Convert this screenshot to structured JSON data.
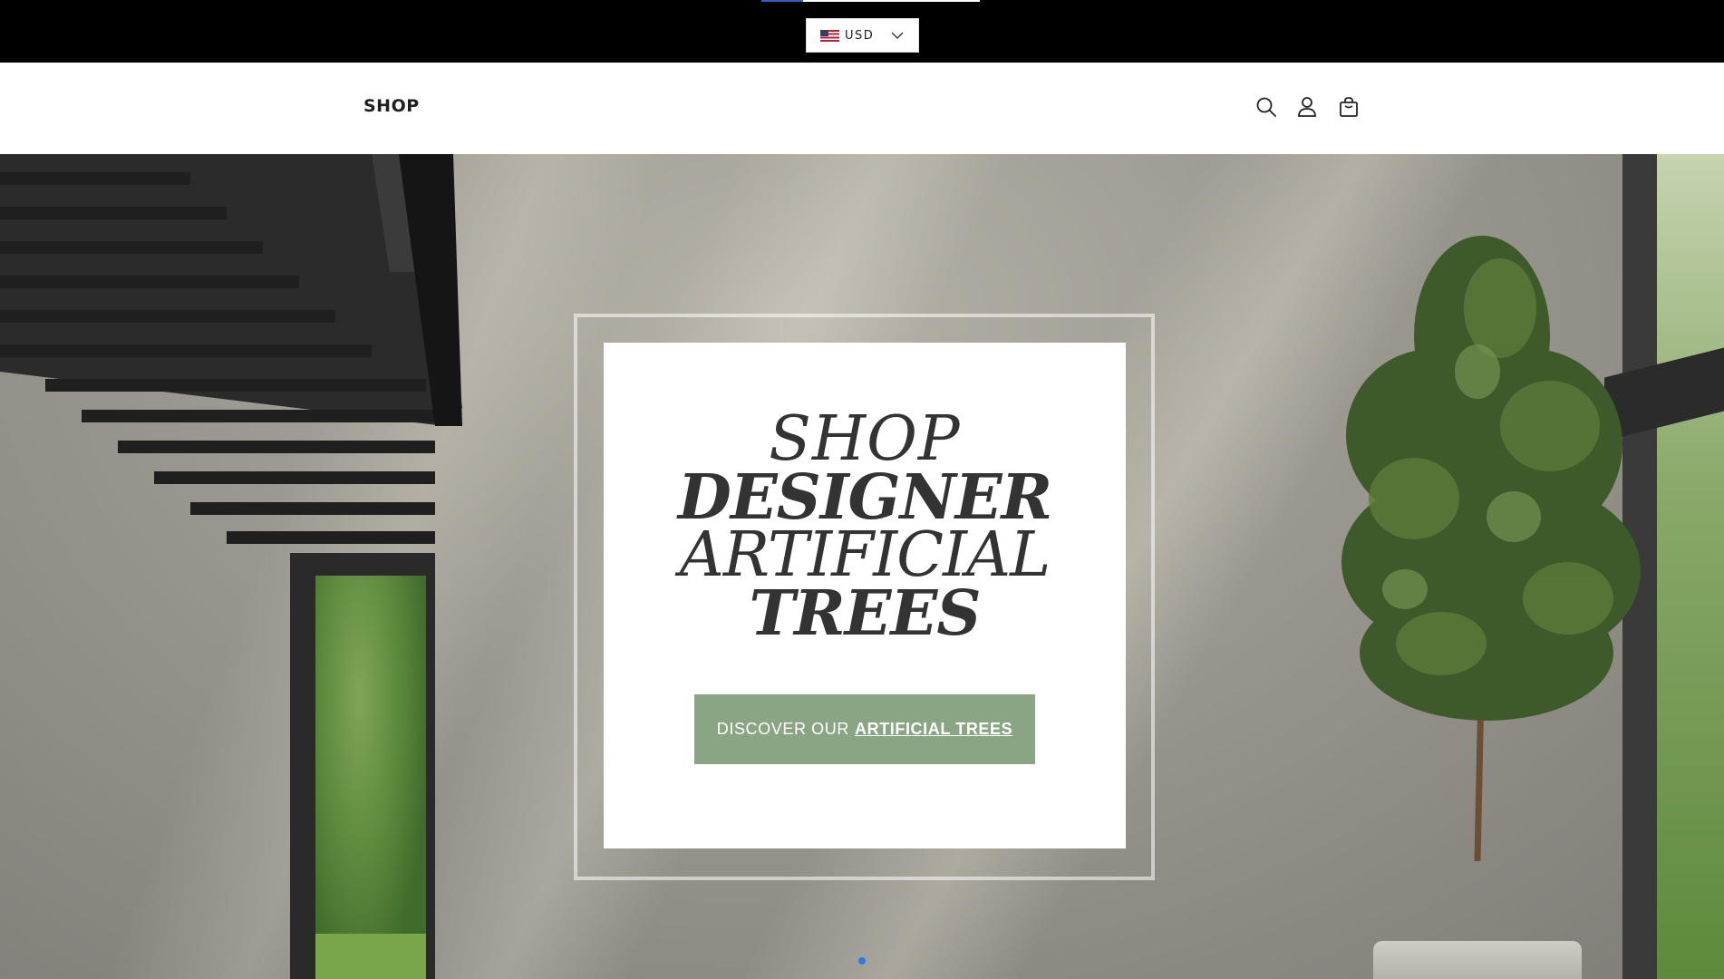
{
  "top_bar": {
    "progress_fraction": 0.19,
    "currency": {
      "flag_icon": "us-flag-icon",
      "label": "USD",
      "chevron_icon": "chevron-down-icon"
    }
  },
  "header": {
    "nav_shop_label": "SHOP",
    "icons": [
      "search-icon",
      "account-icon",
      "cart-icon"
    ]
  },
  "hero": {
    "headline": {
      "line1": "SHOP",
      "line2": "DESIGNER",
      "line3": "ARTIFICIAL",
      "line4": "TREES"
    },
    "cta": {
      "prefix": "DISCOVER OUR",
      "emphasis": "ARTIFICIAL TREES",
      "color": "#89a583"
    },
    "slideshow": {
      "active_dot_color": "#2a7bea",
      "slide_count": 1,
      "active_index": 0
    }
  },
  "colors": {
    "top_bar_bg": "#000000",
    "header_bg": "#ffffff",
    "text_dark": "#333333"
  }
}
